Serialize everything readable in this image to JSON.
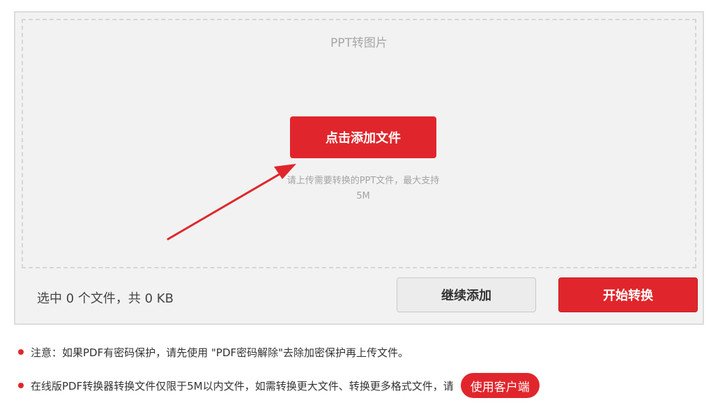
{
  "upload": {
    "title": "PPT转图片",
    "add_file_label": "点击添加文件",
    "hint_line1": "请上传需要转换的PPT文件，最大支持",
    "hint_line2": "5M"
  },
  "footer": {
    "file_summary": "选中 0 个文件，共 0 KB",
    "continue_label": "继续添加",
    "convert_label": "开始转换"
  },
  "notes": {
    "note1": "注意：如果PDF有密码保护，请先使用 \"PDF密码解除\"去除加密保护再上传文件。",
    "note2": "在线版PDF转换器转换文件仅限于5M以内文件，如需转换更大文件、转换更多格式文件，请",
    "client_button": "使用客户端"
  },
  "colors": {
    "accent": "#e0262c",
    "panel_bg": "#f2f2f2"
  }
}
